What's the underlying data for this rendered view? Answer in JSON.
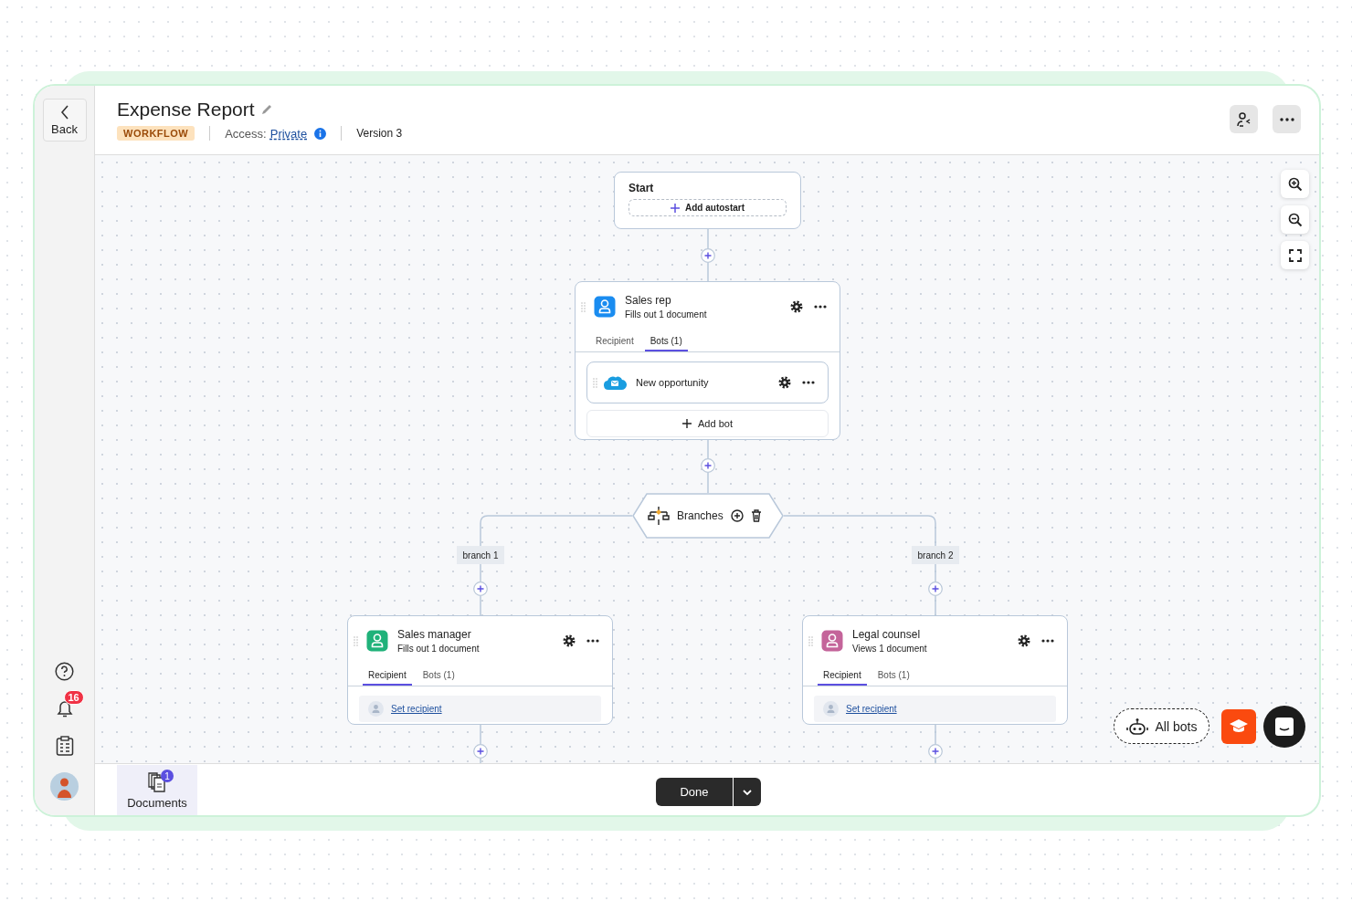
{
  "sidebar": {
    "back": "Back",
    "notifications_badge": "16"
  },
  "header": {
    "title": "Expense Report",
    "type_badge": "WORKFLOW",
    "access_label": "Access:",
    "access_value": "Private",
    "version": "Version 3"
  },
  "canvas": {
    "start": {
      "title": "Start",
      "add_autostart": "Add autostart"
    },
    "step": {
      "name": "Sales rep",
      "subtitle": "Fills out 1 document",
      "color": "#1a8cf0",
      "tabs": [
        {
          "label": "Recipient",
          "selected": false
        },
        {
          "label": "Bots (1)",
          "selected": true
        }
      ],
      "bots": [
        {
          "name": "New opportunity"
        }
      ],
      "add_bot": "Add bot"
    },
    "branches": {
      "label": "Branches",
      "items": [
        {
          "label": "branch 1",
          "step": {
            "name": "Sales manager",
            "subtitle": "Fills out 1 document",
            "color": "#20b27a",
            "tabs": [
              {
                "label": "Recipient",
                "selected": true
              },
              {
                "label": "Bots (1)",
                "selected": false
              }
            ],
            "recipient_link": "Set recipient"
          }
        },
        {
          "label": "branch 2",
          "step": {
            "name": "Legal counsel",
            "subtitle": "Views 1 document",
            "color": "#c4649a",
            "tabs": [
              {
                "label": "Recipient",
                "selected": true
              },
              {
                "label": "Bots (1)",
                "selected": false
              }
            ],
            "recipient_link": "Set recipient"
          }
        }
      ]
    },
    "all_bots": "All bots"
  },
  "footer": {
    "documents": {
      "label": "Documents",
      "badge": "1"
    },
    "done": "Done"
  }
}
